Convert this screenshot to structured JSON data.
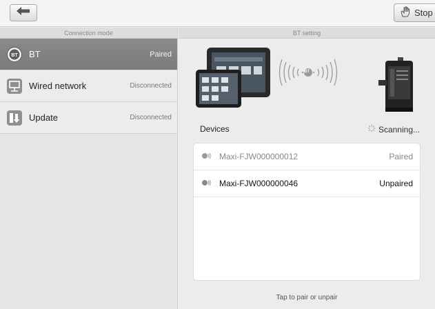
{
  "toolbar": {
    "back_icon": "back-arrow-icon",
    "stop_label": "Stop",
    "stop_icon": "stop-hand-icon"
  },
  "left_pane": {
    "header": "Connection mode",
    "items": [
      {
        "label": "BT",
        "status": "Paired",
        "icon": "bluetooth-icon",
        "selected": true
      },
      {
        "label": "Wired network",
        "status": "Disconnected",
        "icon": "wired-network-icon",
        "selected": false
      },
      {
        "label": "Update",
        "status": "Disconnected",
        "icon": "update-icon",
        "selected": false
      }
    ]
  },
  "right_pane": {
    "header": "BT setting",
    "illustration_badge": "BT",
    "devices_title": "Devices",
    "scanning_text": "Scanning...",
    "devices": [
      {
        "name": "Maxi-FJW000000012",
        "status": "Paired"
      },
      {
        "name": "Maxi-FJW000000046",
        "status": "Unpaired"
      }
    ],
    "hint": "Tap to pair or unpair"
  },
  "colors": {
    "selected_item": "#808080",
    "accent_blue": "#4a7fc1"
  }
}
